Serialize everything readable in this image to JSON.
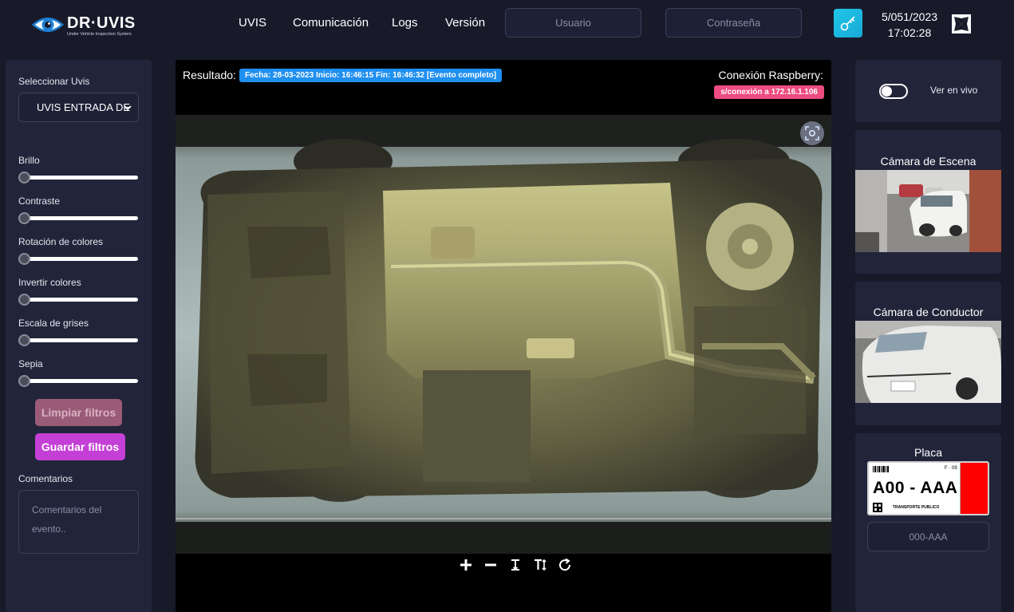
{
  "header": {
    "logo": {
      "title": "DR·UVIS",
      "subtitle": "Under Vehicle Inspection System"
    },
    "nav": [
      "UVIS",
      "Comunicación",
      "Logs",
      "Versión"
    ],
    "user_placeholder": "Usuario",
    "password_placeholder": "Contraseña",
    "date": "5/051/2023",
    "time": "17:02:28",
    "key_icon": "key-icon",
    "cross_icon": "maltese-cross-icon"
  },
  "sidebar": {
    "select_label": "Seleccionar Uvis",
    "select_value": "UVIS ENTRADA DE",
    "sliders": [
      {
        "label": "Brillo",
        "value": 0
      },
      {
        "label": "Contraste",
        "value": 0
      },
      {
        "label": "Rotación de colores",
        "value": 0
      },
      {
        "label": "Invertir colores",
        "value": 0
      },
      {
        "label": "Escala de grises",
        "value": 0
      },
      {
        "label": "Sepia",
        "value": 0
      }
    ],
    "clear_button": "Limpiar filtros",
    "save_button": "Guardar filtros",
    "comments_label": "Comentarios",
    "comments_placeholder": "Comentarios del evento.."
  },
  "main": {
    "result_label": "Resultado:",
    "result_badge": "Fecha: 28-03-2023 Inicio: 16:46:15 Fin: 16:46:32 [Evento completo]",
    "connection_label": "Conexión Raspberry:",
    "connection_badge": "s/conexión a 172.16.1.106",
    "toolbar_icons": [
      "zoom-in-icon",
      "zoom-out-icon",
      "fit-height-icon",
      "text-size-icon",
      "rotate-icon"
    ]
  },
  "right": {
    "live_label": "Ver en vivo",
    "live_on": false,
    "scene_camera_title": "Cámara de Escena",
    "driver_camera_title": "Cámara de Conductor",
    "plate_title": "Placa",
    "plate_number": "A00 - AAA",
    "plate_top_text": "F · 09",
    "plate_bottom_text": "TRANSPORTE PUBLICO",
    "plate_input_placeholder": "000-AAA"
  },
  "colors": {
    "background": "#181a2a",
    "panel": "#22253a",
    "badge_blue": "#1f8ff0",
    "badge_pink": "#ed4c80",
    "save_button": "#c43fd6",
    "clear_button": "#9a5b76",
    "key_button": "#1fc6e6"
  }
}
